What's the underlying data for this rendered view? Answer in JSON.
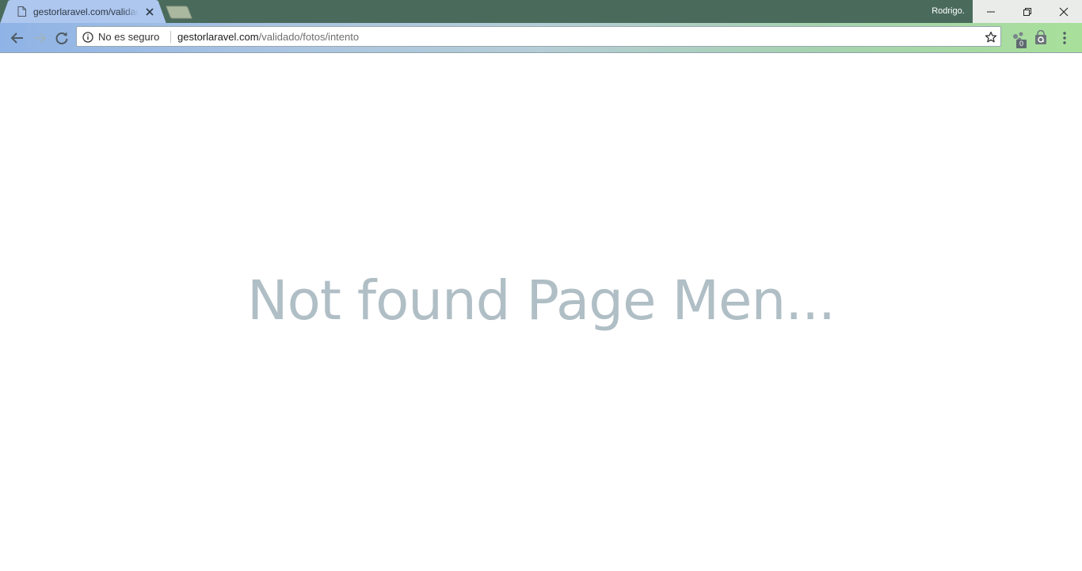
{
  "browser": {
    "tab": {
      "title": "gestorlaravel.com/validado/fotos/intento",
      "icon": "document-icon"
    },
    "profile_name": "Rodrigo.",
    "window_buttons": [
      "minimize",
      "restore",
      "close"
    ],
    "toolbar": {
      "security_label": "No es seguro",
      "url_host": "gestorlaravel.com",
      "url_path": "/validado/fotos/intento",
      "extension_badge": "0"
    },
    "colors": {
      "frame": "#4a6b5c",
      "toolbar_gradient_start": "#8fb3e6",
      "toolbar_gradient_end": "#a8e09a"
    }
  },
  "page": {
    "message": "Not found Page Men...",
    "message_color": "#b0bec5",
    "background": "#ffffff"
  }
}
